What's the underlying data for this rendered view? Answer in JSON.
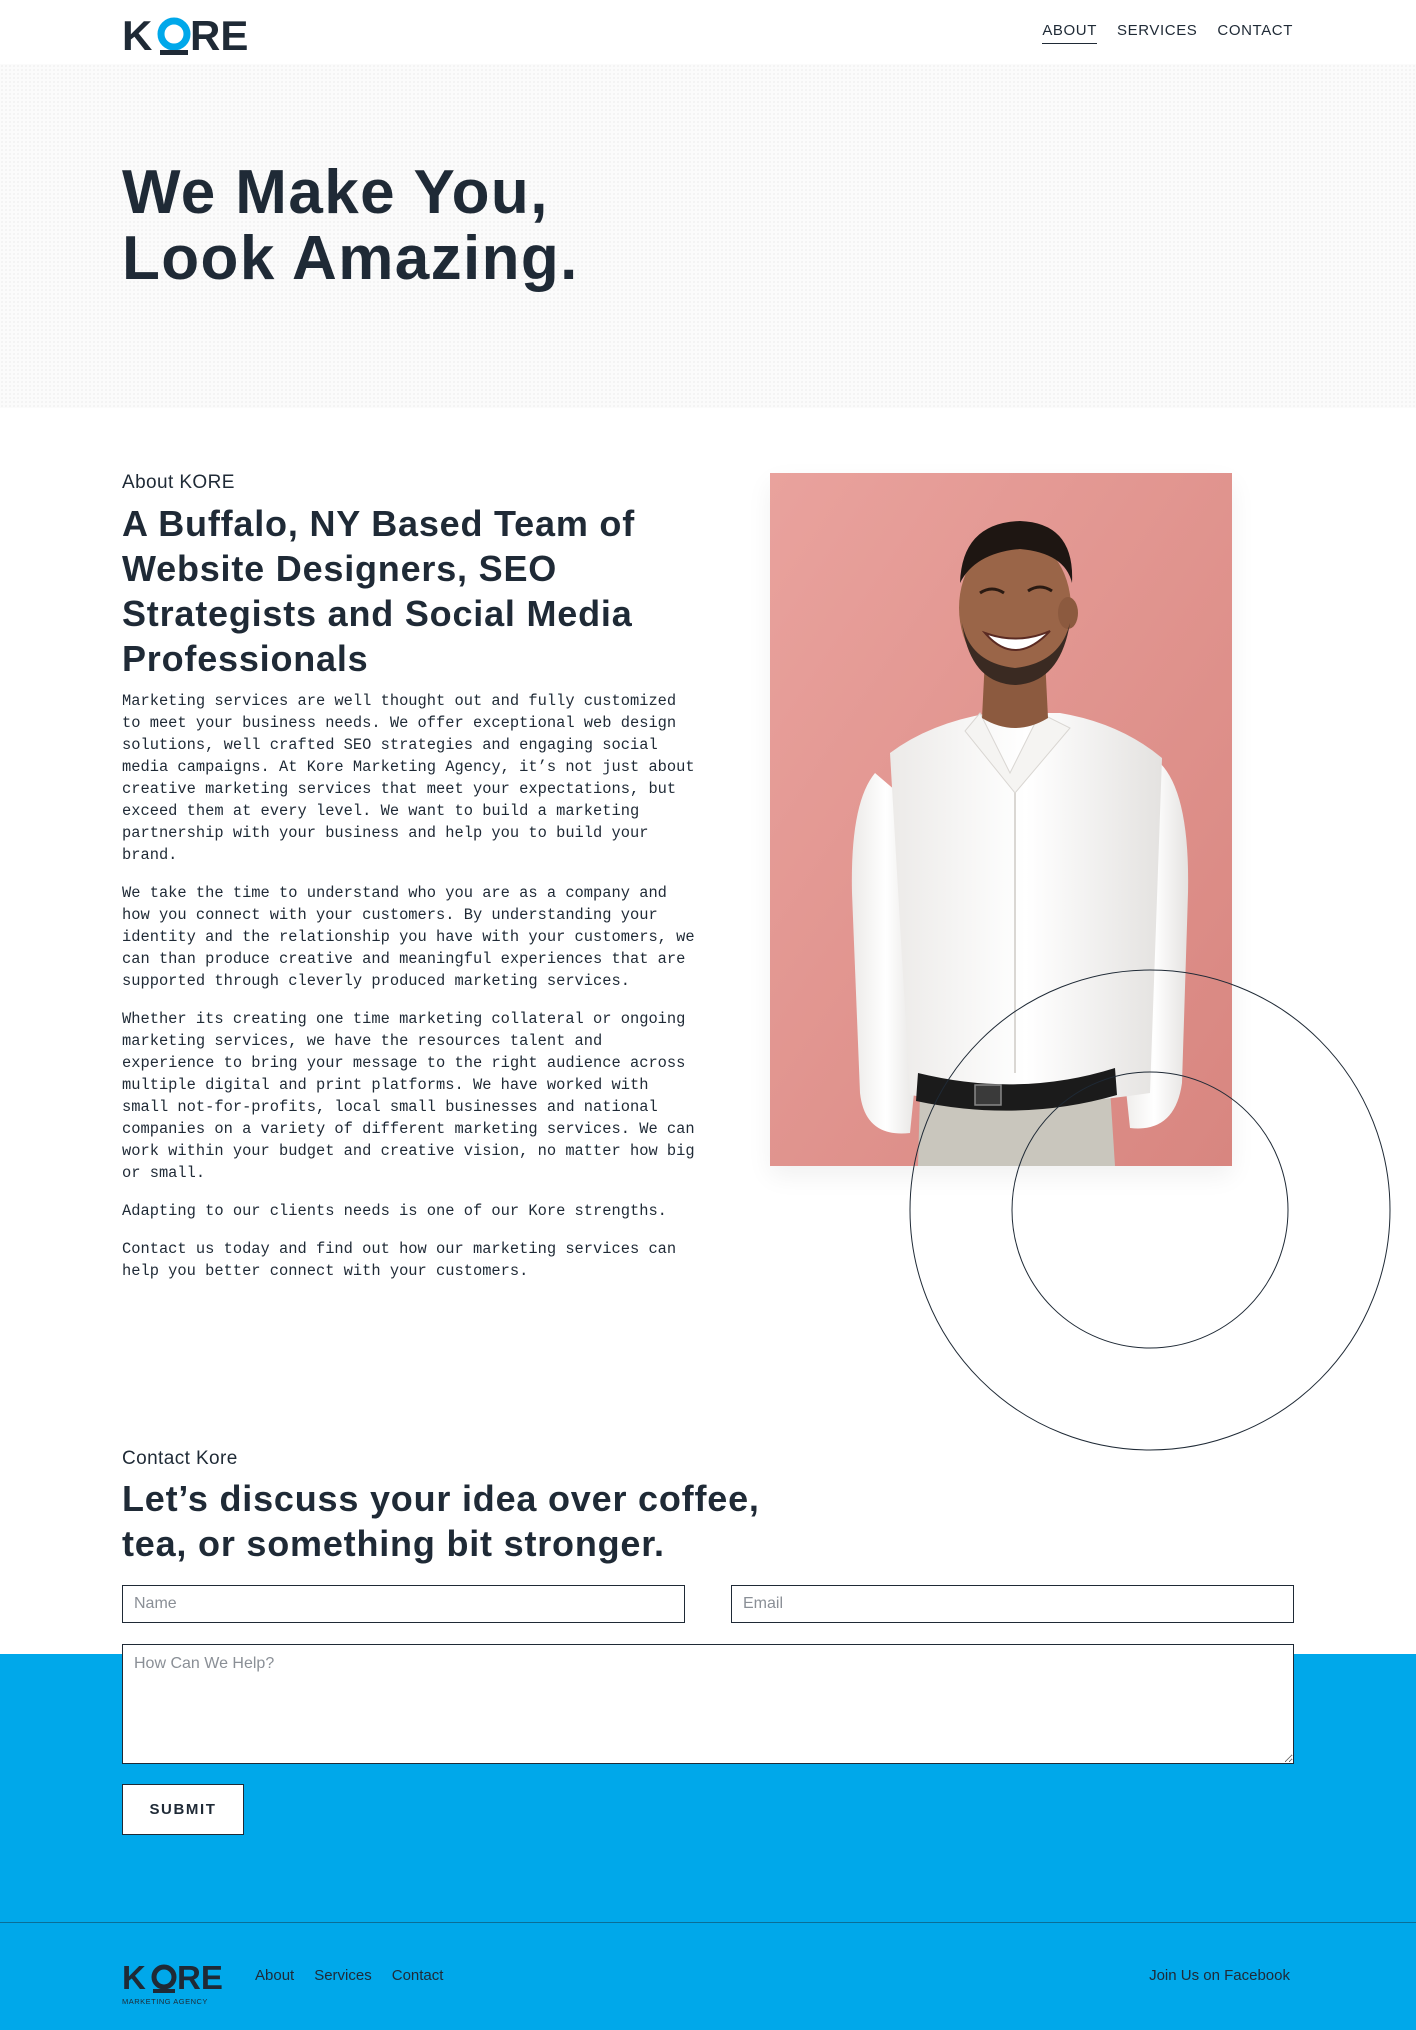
{
  "brand": {
    "logo_text": "KORE",
    "footer_logo_text": "KORE",
    "footer_tagline": "MARKETING AGENCY",
    "accent_color": "#00a8ea",
    "text_color": "#1f2a36"
  },
  "nav": {
    "items": [
      {
        "label": "ABOUT",
        "active": true
      },
      {
        "label": "SERVICES",
        "active": false
      },
      {
        "label": "CONTACT",
        "active": false
      }
    ]
  },
  "hero": {
    "title_line1": "We Make You,",
    "title_line2": "Look Amazing."
  },
  "about": {
    "eyebrow": "About KORE",
    "heading": "A Buffalo, NY Based Team of Website Designers, SEO Strategists and Social Media Professionals",
    "paragraphs": [
      "Marketing services are well thought out and fully customized to meet your business needs. We offer exceptional web design solutions, well crafted SEO strategies and engaging social media campaigns. At Kore Marketing Agency, it’s not just about creative marketing services that meet your expectations, but exceed them at every level. We want to build a marketing partnership with your business and help you to build your brand.",
      "We take the time to understand who you are as a company and how you connect with your customers. By understanding your identity and the relationship you have with your customers, we can than produce creative and meaningful experiences that are supported through cleverly produced marketing services.",
      "Whether its creating one time marketing collateral or ongoing marketing services, we have the resources talent and experience to bring your message to the right audience across multiple digital and print platforms. We have worked with small not-for-profits, local small businesses and national companies on a variety of different marketing services. We can work within your budget and creative vision, no matter how big or small.",
      "Adapting to our clients needs is one of our Kore strengths.",
      "Contact us today and find out how our marketing services can help you better connect with your customers."
    ],
    "photo_icon": "smiling-man-portrait"
  },
  "contact": {
    "eyebrow": "Contact Kore",
    "heading_line1": "Let’s discuss your idea over coffee,",
    "heading_line2": "tea, or something bit stronger.",
    "name_placeholder": "Name",
    "email_placeholder": "Email",
    "message_placeholder": "How Can We Help?",
    "submit_label": "SUBMIT"
  },
  "footer": {
    "links": [
      "About",
      "Services",
      "Contact"
    ],
    "social_link": "Join Us on Facebook"
  }
}
